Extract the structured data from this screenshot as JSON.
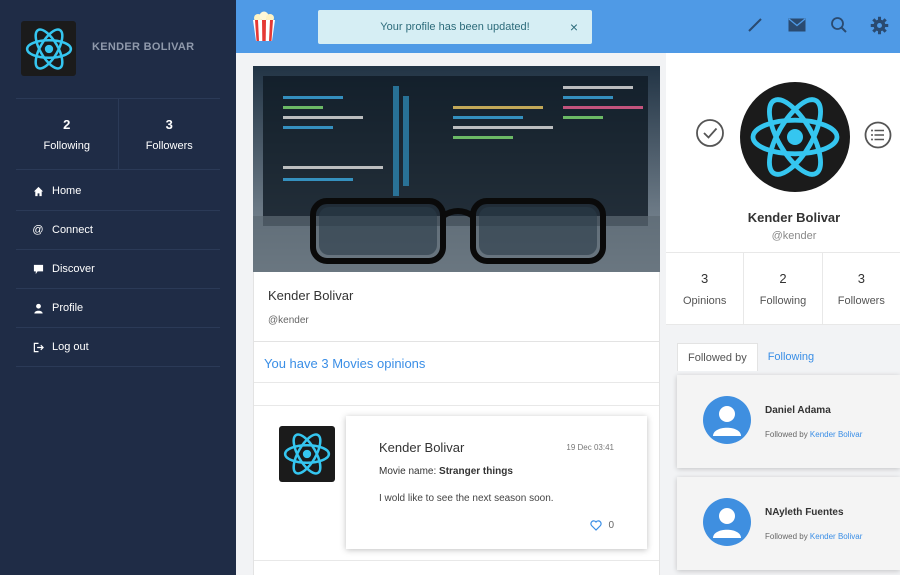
{
  "sidebar": {
    "user_name": "KENDER BOLIVAR",
    "stats": [
      {
        "value": "2",
        "label": "Following"
      },
      {
        "value": "3",
        "label": "Followers"
      }
    ],
    "nav": [
      {
        "label": "Home",
        "icon": "home-icon"
      },
      {
        "label": "Connect",
        "icon": "at-icon"
      },
      {
        "label": "Discover",
        "icon": "chat-icon"
      },
      {
        "label": "Profile",
        "icon": "user-icon"
      },
      {
        "label": "Log out",
        "icon": "logout-icon"
      }
    ]
  },
  "topbar": {
    "toast_message": "Your profile has been updated!",
    "toast_close": "×",
    "icons": [
      "pen-icon",
      "mail-icon",
      "search-icon",
      "gear-icon"
    ],
    "accent": "#4f9ae6"
  },
  "profile_card": {
    "name": "Kender Bolivar",
    "handle": "@kender"
  },
  "opinions": {
    "title": "You have 3 Movies opinions",
    "items": [
      {
        "author": "Kender Bolivar",
        "date": "19 Dec 03:41",
        "movie_label": "Movie name:",
        "movie": "Stranger things",
        "text": "I wold like to see the next season soon.",
        "likes": "0"
      }
    ]
  },
  "right_panel": {
    "name": "Kender Bolivar",
    "handle": "@kender",
    "stats": [
      {
        "value": "3",
        "label": "Opinions"
      },
      {
        "value": "2",
        "label": "Following"
      },
      {
        "value": "3",
        "label": "Followers"
      }
    ],
    "tabs": [
      "Followed by",
      "Following"
    ],
    "followers": [
      {
        "name": "Daniel Adama",
        "by_label": "Followed by",
        "by": "Kender Bolivar"
      },
      {
        "name": "NAyleth Fuentes",
        "by_label": "Followed by",
        "by": "Kender Bolivar"
      }
    ]
  }
}
